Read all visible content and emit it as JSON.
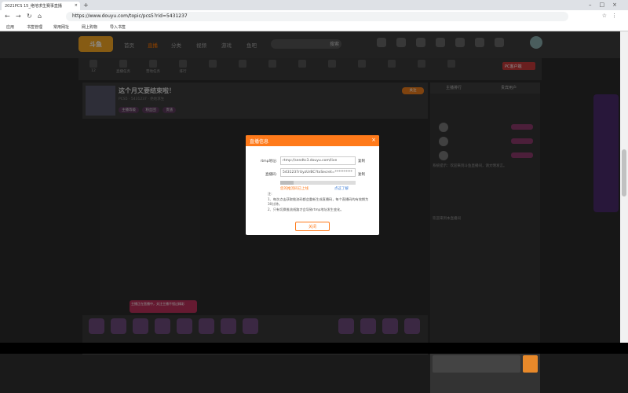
{
  "browser": {
    "tab_title": "2021PCS 15_绝地求生赛事直播",
    "tab_close": "×",
    "newtab": "+",
    "window_buttons": "–□×",
    "back": "←",
    "forward": "→",
    "reload": "↻",
    "home": "⌂",
    "url": "https://www.douyu.com/topic/pcs5?rid=5431237",
    "toolbar_icons": "☆⋮",
    "bookmarks": [
      "应用",
      "书签管理",
      "常用网址",
      "网上购物",
      "导入书签"
    ]
  },
  "header": {
    "logo": "斗鱼",
    "nav": [
      "首页",
      "直播",
      "分类",
      "视频",
      "游戏",
      "鱼吧"
    ],
    "active_nav": "直播",
    "search_btn": "搜索"
  },
  "subbar": {
    "items": [
      "12",
      "直播任务",
      "营地任务",
      "排行",
      "",
      "",
      "",
      "",
      "",
      "",
      "",
      "",
      ""
    ],
    "pc_button": "PC客户端"
  },
  "room": {
    "title": "这个月又要结束啦！",
    "meta": "PCS5 · 5431237 · 绝地求生",
    "tags": [
      "主播等级",
      "粉丝团",
      "贵族"
    ],
    "follow": "关注",
    "promo_text": "主播正在直播中，关注主播不错过精彩"
  },
  "sidepanel": {
    "tab_left": "主播排行",
    "tab_right": "贵宾用户",
    "ranks": [
      "",
      "",
      ""
    ],
    "chat": "系统提示：欢迎来到斗鱼直播间，请文明发言。",
    "chat2": "欢迎来到本直播间"
  },
  "dialog": {
    "title": "直播信息",
    "close": "×",
    "rtmp_label": "rtmp地址:",
    "rtmp_value": "rtmp://sendtc3.douyu.com/live",
    "code_label": "直播码:",
    "code_value": "5431237rUyzUrBC?txSecret=**********",
    "copy": "复制",
    "warn": "您的推流码已上线",
    "more": "点这了解",
    "notes": [
      "注:",
      "1、每次点击获取推流码都会重新生成直播码，每个直播码的有效期为30分钟。",
      "2、只有切换推流线路才会导致rtmp地址发生变化。"
    ],
    "close_btn": "关闭"
  },
  "colors": {
    "accent": "#ff7a1a",
    "dark_bg": "#2a2a2a"
  }
}
